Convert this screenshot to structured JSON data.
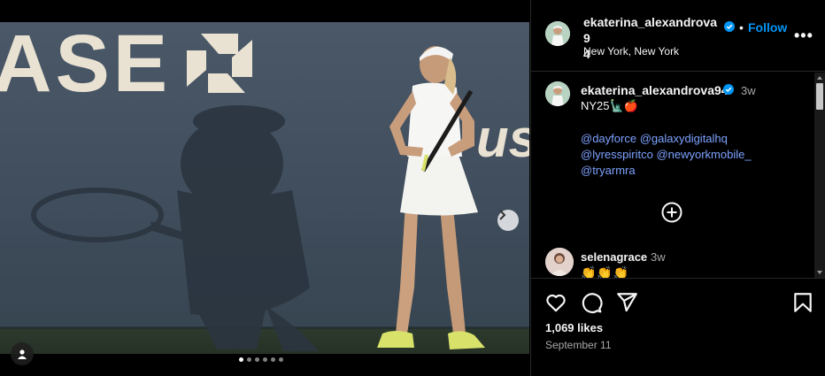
{
  "post": {
    "username": "ekaterina_alexandrova94",
    "header_username_line1": "ekaterina_alexandrova9",
    "header_username_line2": "4",
    "separator": "•",
    "follow_label": "Follow",
    "location": "New York, New York",
    "more_label": "•••",
    "verified": true,
    "image_count": 6,
    "active_image_index": 0
  },
  "photo": {
    "banner_text": "ASE",
    "brand_text": "us"
  },
  "caption": {
    "username": "ekaterina_alexandrova94",
    "time": "3w",
    "text": "NY25🗽🍎",
    "mentions": [
      "@dayforce",
      "@galaxydigitalhq",
      "@lyresspiritco",
      "@newyorkmobile_",
      "@tryarmra"
    ]
  },
  "comments": [
    {
      "username": "selenagrace",
      "time": "3w",
      "text": "👏👏👏"
    }
  ],
  "footer": {
    "likes": "1,069 likes",
    "date": "September 11"
  },
  "icons": {
    "like": "heart-icon",
    "comment": "comment-icon",
    "share": "share-icon",
    "save": "bookmark-icon",
    "next": "chevron-right-icon",
    "tag": "user-tag-icon",
    "load_more": "plus-circle-icon"
  },
  "colors": {
    "accent": "#0095f6",
    "mention": "#7da2ff",
    "background": "#000000",
    "muted_text": "#a8a8a8"
  }
}
